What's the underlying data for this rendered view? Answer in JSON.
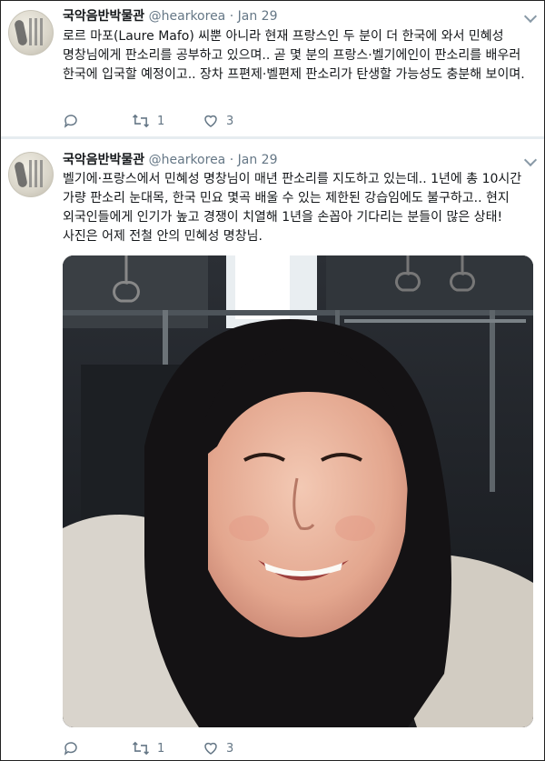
{
  "tweets": [
    {
      "author_name": "국악음반박물관",
      "handle": "@hearkorea",
      "dot": "·",
      "date": "Jan 29",
      "text": "로르 마포(Laure Mafo) 씨뿐 아니라 현재 프랑스인 두 분이 더 한국에 와서 민혜성 명창님에게 판소리를 공부하고 있으며.. 곧 몇 분의 프랑스·벨기에인이 판소리를 배우러 한국에 입국할 예정이고.. 장차 프편제·벨편제 판소리가 탄생할 가능성도 충분해 보이며.",
      "replies": "",
      "retweets": "1",
      "likes": "3"
    },
    {
      "author_name": "국악음반박물관",
      "handle": "@hearkorea",
      "dot": "·",
      "date": "Jan 29",
      "text": "벨기에·프랑스에서 민혜성 명창님이 매년 판소리를 지도하고 있는데.. 1년에 총 10시간 가량 판소리 눈대목, 한국 민요 몇곡 배울 수 있는 제한된 강습임에도 불구하고.. 현지 외국인들에게 인기가 높고 경쟁이 치열해 1년을 손꼽아 기다리는 분들이 많은 상태! 사진은 어제 전철 안의 민혜성 명창님.",
      "replies": "",
      "retweets": "1",
      "likes": "3"
    }
  ],
  "icons": {
    "reply": "reply-icon",
    "retweet": "retweet-icon",
    "like": "heart-icon",
    "more": "chevron-down-icon"
  },
  "colors": {
    "text": "#14171a",
    "muted": "#657786",
    "divider": "#e6ecf0"
  }
}
